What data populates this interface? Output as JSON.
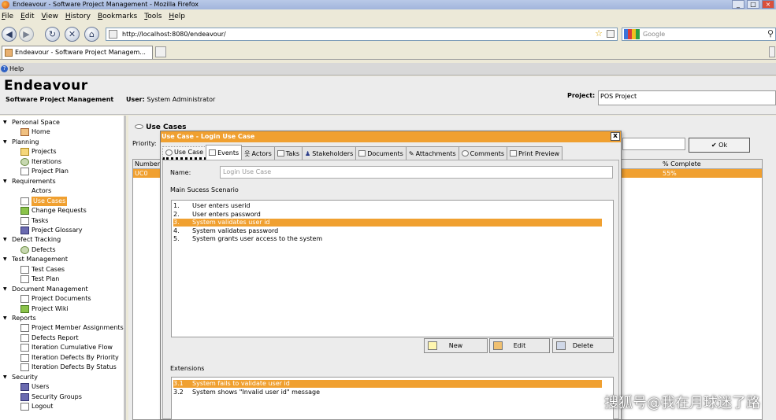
{
  "window": {
    "title": "Endeavour - Software Project Management - Mozilla Firefox"
  },
  "menu": [
    "File",
    "Edit",
    "View",
    "History",
    "Bookmarks",
    "Tools",
    "Help"
  ],
  "nav": {
    "url": "http://localhost:8080/endeavour/",
    "search_placeholder": "Google"
  },
  "tab": {
    "label": "Endeavour - Software Project Managem..."
  },
  "helpbar": {
    "label": "Help"
  },
  "app": {
    "brand": "Endeavour",
    "subtitle": "Software Project Management",
    "user_label": "User:",
    "user_name": "System Administrator",
    "project_label": "Project:",
    "project_value": "POS Project"
  },
  "sidebar": {
    "items": [
      {
        "label": "Personal Space",
        "type": "group"
      },
      {
        "label": "Home",
        "type": "leaf",
        "icon": "home-icon"
      },
      {
        "label": "Planning",
        "type": "group"
      },
      {
        "label": "Projects",
        "type": "leaf",
        "icon": "folder-icon"
      },
      {
        "label": "Iterations",
        "type": "leaf",
        "icon": "refresh-icon"
      },
      {
        "label": "Project Plan",
        "type": "leaf",
        "icon": "plan-icon"
      },
      {
        "label": "Requirements",
        "type": "group"
      },
      {
        "label": "Actors",
        "type": "leaf",
        "icon": "actor-icon"
      },
      {
        "label": "Use Cases",
        "type": "leaf",
        "icon": "usecase-icon",
        "selected": true
      },
      {
        "label": "Change Requests",
        "type": "leaf",
        "icon": "change-request-icon"
      },
      {
        "label": "Tasks",
        "type": "leaf",
        "icon": "task-icon"
      },
      {
        "label": "Project Glossary",
        "type": "leaf",
        "icon": "glossary-icon"
      },
      {
        "label": "Defect Tracking",
        "type": "group"
      },
      {
        "label": "Defects",
        "type": "leaf",
        "icon": "bug-icon"
      },
      {
        "label": "Test Management",
        "type": "group"
      },
      {
        "label": "Test Cases",
        "type": "leaf",
        "icon": "test-case-icon"
      },
      {
        "label": "Test Plan",
        "type": "leaf",
        "icon": "test-plan-icon"
      },
      {
        "label": "Document Management",
        "type": "group"
      },
      {
        "label": "Project Documents",
        "type": "leaf",
        "icon": "documents-icon"
      },
      {
        "label": "Project Wiki",
        "type": "leaf",
        "icon": "wiki-icon"
      },
      {
        "label": "Reports",
        "type": "group"
      },
      {
        "label": "Project Member Assignments",
        "type": "leaf",
        "icon": "report-icon"
      },
      {
        "label": "Defects Report",
        "type": "leaf",
        "icon": "report-icon"
      },
      {
        "label": "Iteration Cumulative Flow",
        "type": "leaf",
        "icon": "report-icon"
      },
      {
        "label": "Iteration Defects By Priority",
        "type": "leaf",
        "icon": "report-icon"
      },
      {
        "label": "Iteration Defects By Status",
        "type": "leaf",
        "icon": "report-icon"
      },
      {
        "label": "Security",
        "type": "group"
      },
      {
        "label": "Users",
        "type": "leaf",
        "icon": "user-icon"
      },
      {
        "label": "Security Groups",
        "type": "leaf",
        "icon": "group-icon"
      },
      {
        "label": "Logout",
        "type": "leaf",
        "icon": "logout-icon"
      }
    ]
  },
  "content": {
    "title": "Use Cases",
    "priority_label": "Priority:",
    "ok_label": "Ok",
    "columns": {
      "number": "Number",
      "complete": "% Complete"
    },
    "row": {
      "number": "UC0",
      "complete": "55%"
    }
  },
  "dialog": {
    "title": "Use Case - Login Use Case",
    "close": "x",
    "tabs": [
      "Use Case",
      "Events",
      "Actors",
      "Taks",
      "Stakeholders",
      "Documents",
      "Attachments",
      "Comments",
      "Print Preview"
    ],
    "active_tab": "Use Case",
    "name_label": "Name:",
    "name_value": "Login Use Case",
    "mss_label": "Main Sucess Scenario",
    "steps": [
      {
        "n": "1.",
        "t": "User enters userid"
      },
      {
        "n": "2.",
        "t": "User enters password"
      },
      {
        "n": "3.",
        "t": "System validates user id",
        "selected": true
      },
      {
        "n": "4.",
        "t": "System validates password"
      },
      {
        "n": "5.",
        "t": "System grants user access to the system"
      }
    ],
    "buttons": {
      "new": "New",
      "edit": "Edit",
      "delete": "Delete"
    },
    "extensions_label": "Extensions",
    "extensions": [
      {
        "n": "3.1",
        "t": "System fails to validate user id",
        "selected": true
      },
      {
        "n": "3.2",
        "t": "System shows \"Invalid user id\" message"
      }
    ]
  },
  "watermark": "搜狐号@我在月球迷了路"
}
